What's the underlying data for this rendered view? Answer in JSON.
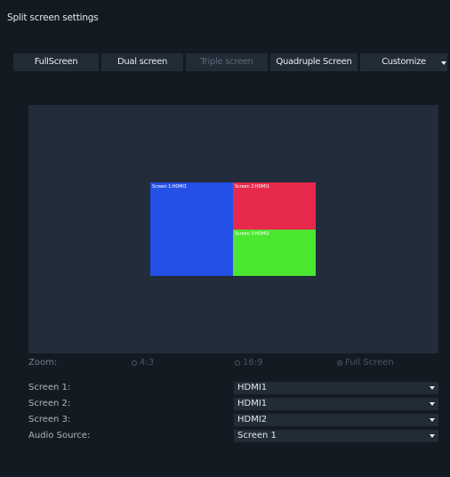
{
  "window": {
    "title": "Split screen settings"
  },
  "tabs": [
    {
      "label": "FullScreen",
      "enabled": true
    },
    {
      "label": "Dual screen",
      "enabled": true
    },
    {
      "label": "Triple screen",
      "enabled": false
    },
    {
      "label": "Quadruple Screen",
      "enabled": true
    },
    {
      "label": "Customize",
      "enabled": true
    }
  ],
  "preview": {
    "windows": [
      {
        "label": "Screen 1:HDMI1",
        "color": "#2550e6"
      },
      {
        "label": "Screen 2:HDMI1",
        "color": "#e8294e"
      },
      {
        "label": "Screen 3:HDMI2",
        "color": "#4be62f"
      }
    ]
  },
  "zoom": {
    "label": "Zoom:",
    "options": [
      "4:3",
      "16:9",
      "Full Screen"
    ],
    "selected": "Full Screen"
  },
  "settings": [
    {
      "label": "Screen 1:",
      "value": "HDMI1"
    },
    {
      "label": "Screen 2:",
      "value": "HDMI1"
    },
    {
      "label": "Screen 3:",
      "value": "HDMI2"
    },
    {
      "label": "Audio Source:",
      "value": "Screen 1"
    }
  ],
  "icons": {
    "tab_dropdown": "chevron-down-icon",
    "select_dropdown": "chevron-down-icon",
    "radio": "radio-icon"
  }
}
